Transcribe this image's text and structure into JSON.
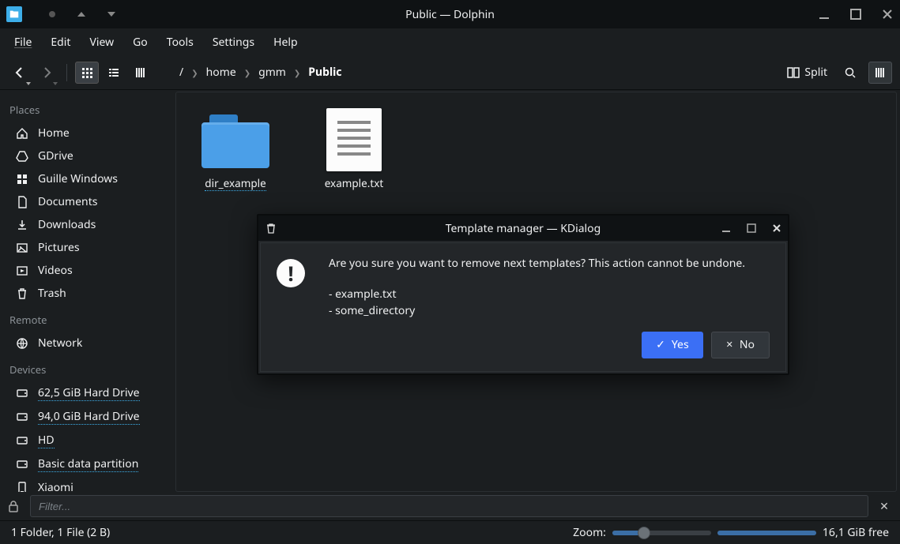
{
  "window": {
    "title": "Public — Dolphin"
  },
  "menubar": [
    "File",
    "Edit",
    "View",
    "Go",
    "Tools",
    "Settings",
    "Help"
  ],
  "breadcrumb": {
    "root": "/",
    "segments": [
      "home",
      "gmm"
    ],
    "current": "Public"
  },
  "toolbar": {
    "split_label": "Split"
  },
  "sidebar": {
    "places_title": "Places",
    "places": [
      {
        "icon": "home",
        "label": "Home"
      },
      {
        "icon": "gdrive",
        "label": "GDrive"
      },
      {
        "icon": "grid",
        "label": "Guille Windows"
      },
      {
        "icon": "doc",
        "label": "Documents"
      },
      {
        "icon": "download",
        "label": "Downloads"
      },
      {
        "icon": "image",
        "label": "Pictures"
      },
      {
        "icon": "video",
        "label": "Videos"
      },
      {
        "icon": "trash",
        "label": "Trash"
      }
    ],
    "remote_title": "Remote",
    "remote": [
      {
        "icon": "network",
        "label": "Network"
      }
    ],
    "devices_title": "Devices",
    "devices": [
      {
        "icon": "disk",
        "label": "62,5 GiB Hard Drive",
        "dotted": true
      },
      {
        "icon": "disk",
        "label": "94,0 GiB Hard Drive",
        "dotted": true
      },
      {
        "icon": "disk",
        "label": "HD",
        "dotted": true
      },
      {
        "icon": "disk",
        "label": "Basic data partition",
        "dotted": true
      },
      {
        "icon": "phone",
        "label": "Xiaomi"
      }
    ]
  },
  "files": [
    {
      "type": "folder",
      "name": "dir_example",
      "dotted": true
    },
    {
      "type": "text",
      "name": "example.txt"
    }
  ],
  "filter": {
    "placeholder": "Filter..."
  },
  "status": {
    "summary": "1 Folder, 1 File (2 B)",
    "zoom_label": "Zoom:",
    "slider1_fill_pct": 32,
    "slider1_knob_pct": 32,
    "slider2_fill_pct": 100,
    "slider2_knob_pct": 100,
    "free": "16,1 GiB free"
  },
  "dialog": {
    "title": "Template manager — KDialog",
    "question": "Are you sure you want to remove next templates? This action cannot be undone.",
    "items": [
      " - example.txt",
      " - some_directory"
    ],
    "yes": "Yes",
    "no": "No"
  }
}
